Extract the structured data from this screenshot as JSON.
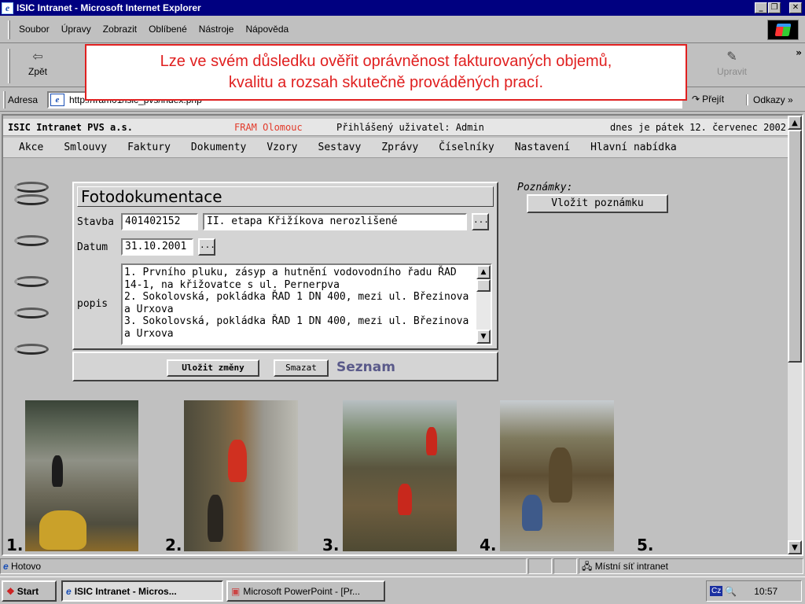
{
  "window": {
    "title": "ISIC Intranet - Microsoft Internet Explorer",
    "controls": [
      "_",
      "×"
    ]
  },
  "menubar": {
    "items": [
      "Soubor",
      "Úpravy",
      "Zobrazit",
      "Oblíbené",
      "Nástroje",
      "Nápověda"
    ]
  },
  "toolbar": {
    "back": "Zpět",
    "edit": "Upravit",
    "more": "»"
  },
  "addressbar": {
    "label": "Adresa",
    "url": "http://fram01/isic_pvs/index.php",
    "go": "Přejít",
    "links": "Odkazy »"
  },
  "callout": {
    "line1": "Lze ve svém důsledku ověřit oprávněnost fakturovaných objemů,",
    "line2": "kvalitu a rozsah skutečně prováděných prací.",
    "color": "#e02020"
  },
  "page": {
    "infobar": {
      "company": "ISIC Intranet PVS a.s.",
      "organisation": "FRAM Olomouc",
      "user": "Přihlášený uživatel: Admin",
      "date": "dnes je pátek 12. červenec 2002"
    },
    "nav": [
      "Akce",
      "Smlouvy",
      "Faktury",
      "Dokumenty",
      "Vzory",
      "Sestavy",
      "Zprávy",
      "Číselníky",
      "Nastavení",
      "Hlavní nabídka"
    ],
    "form": {
      "title": "Fotodokumentace",
      "stavba_label": "Stavba",
      "stavba_code": "401402152",
      "stavba_name": "II. etapa Křižíkova nerozlišené",
      "datum_label": "Datum",
      "datum_value": "31.10.2001",
      "popis_label": "popis",
      "popis_lines": [
        "1. Prvního pluku, zásyp a hutnění vodovodního řadu ŘAD",
        "14-1, na křižovatce s ul. Pernerpva",
        "2. Sokolovská, pokládka ŘAD 1 DN 400, mezi ul. Březinova",
        "a Urxova",
        "3. Sokolovská, pokládka ŘAD 1 DN 400, mezi ul. Březinova",
        "a Urxova"
      ],
      "ellipsis": "..."
    },
    "actions": {
      "save": "Uložit změny",
      "delete": "Smazat",
      "list": "Seznam"
    },
    "notes": {
      "label": "Poznámky:",
      "add": "Vložit poznámku"
    },
    "photos": [
      "1.",
      "2.",
      "3.",
      "4.",
      "5."
    ]
  },
  "statusbar": {
    "status": "Hotovo",
    "zone": "Místní síť intranet"
  },
  "taskbar": {
    "start": "Start",
    "tasks": [
      "ISIC Intranet - Micros...",
      "Microsoft PowerPoint - [Pr..."
    ],
    "lang": "Cz",
    "time": "10:57"
  }
}
